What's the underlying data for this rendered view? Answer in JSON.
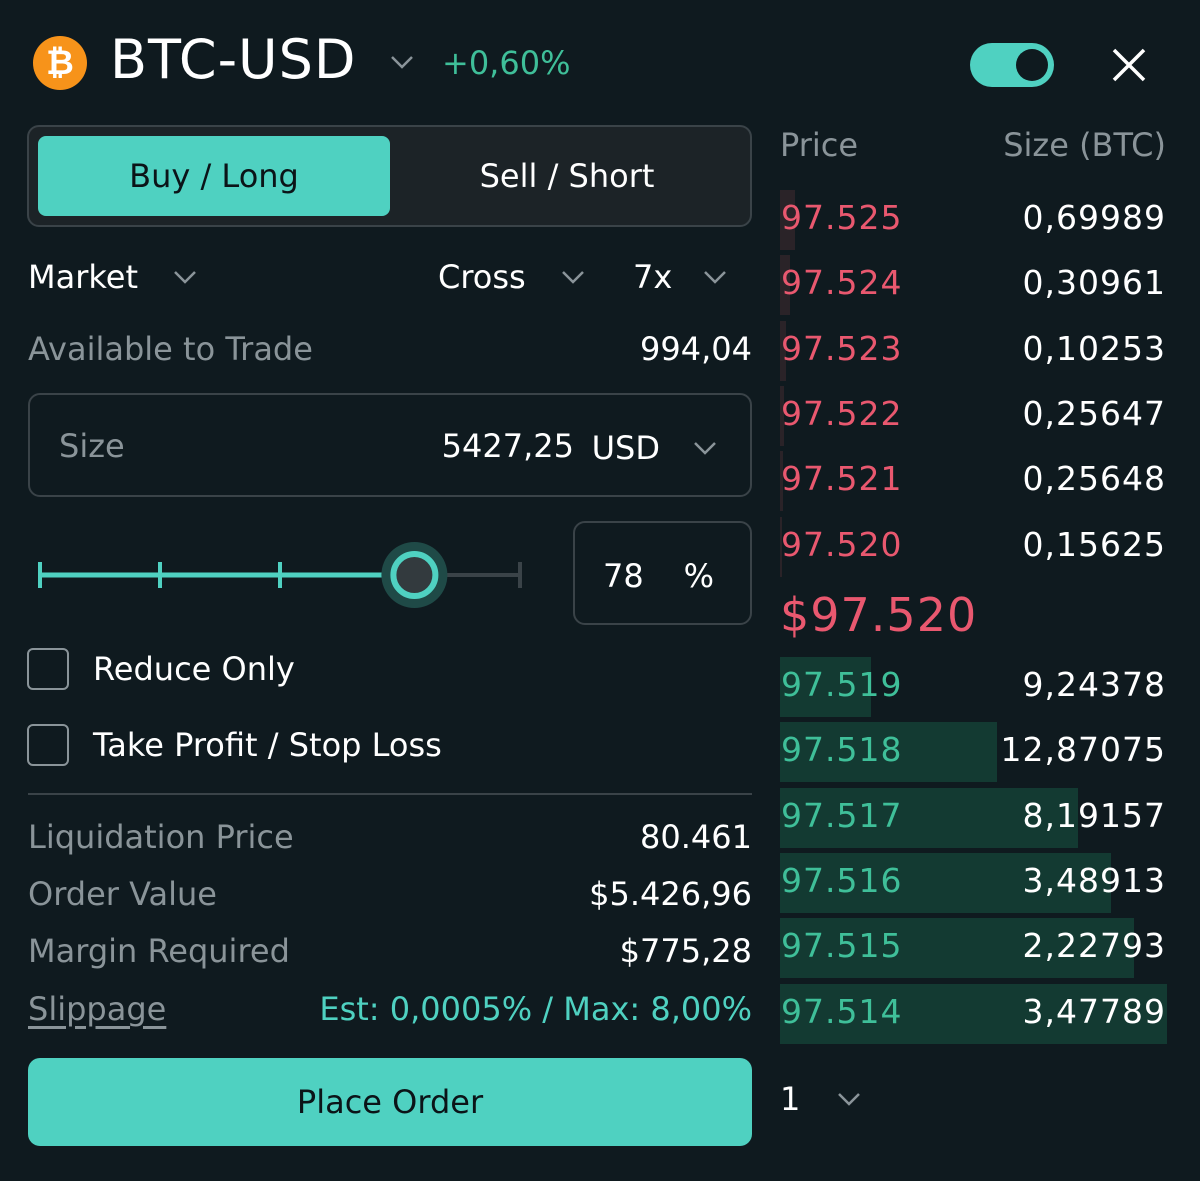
{
  "header": {
    "coin_symbol": "₿",
    "pair": "BTC-USD",
    "change": "+0,60%",
    "toggle_on": true
  },
  "order_side": {
    "buy_label": "Buy / Long",
    "sell_label": "Sell / Short",
    "selected": "buy"
  },
  "order_options": {
    "type": "Market",
    "margin_mode": "Cross",
    "leverage": "7x"
  },
  "available": {
    "label": "Available to Trade",
    "value": "994,04"
  },
  "size": {
    "label": "Size",
    "value": "5427,25",
    "unit": "USD"
  },
  "slider": {
    "percent_value": "78",
    "percent_sign": "%",
    "level": 0.78
  },
  "checkboxes": {
    "reduce_only": "Reduce Only",
    "tp_sl": "Take Profit / Stop Loss"
  },
  "info": {
    "liq_label": "Liquidation Price",
    "liq_value": "80.461",
    "order_value_label": "Order Value",
    "order_value": "$5.426,96",
    "margin_label": "Margin Required",
    "margin_value": "$775,28",
    "slippage_label": "Slippage",
    "slippage_value": "Est: 0,0005% / Max: 8,00%"
  },
  "place_order_label": "Place Order",
  "orderbook": {
    "price_header": "Price",
    "size_header": "Size (BTC)",
    "asks": [
      {
        "price": "97.525",
        "size": "0,69989",
        "depth": 0.04
      },
      {
        "price": "97.524",
        "size": "0,30961",
        "depth": 0.025
      },
      {
        "price": "97.523",
        "size": "0,10253",
        "depth": 0.015
      },
      {
        "price": "97.522",
        "size": "0,25647",
        "depth": 0.01
      },
      {
        "price": "97.521",
        "size": "0,25648",
        "depth": 0.007
      },
      {
        "price": "97.520",
        "size": "0,15625",
        "depth": 0.004
      }
    ],
    "mid_price": "$97.520",
    "bids": [
      {
        "price": "97.519",
        "size": "9,24378",
        "depth": 0.235
      },
      {
        "price": "97.518",
        "size": "12,87075",
        "depth": 0.56
      },
      {
        "price": "97.517",
        "size": "8,19157",
        "depth": 0.77
      },
      {
        "price": "97.516",
        "size": "3,48913",
        "depth": 0.855
      },
      {
        "price": "97.515",
        "size": "2,22793",
        "depth": 0.915
      },
      {
        "price": "97.514",
        "size": "3,47789",
        "depth": 1.0
      }
    ],
    "grouping": "1"
  },
  "colors": {
    "accent": "#4fd1c1",
    "ask": "#e9586f",
    "bid": "#3fbf99",
    "background": "#0f1a1f"
  }
}
